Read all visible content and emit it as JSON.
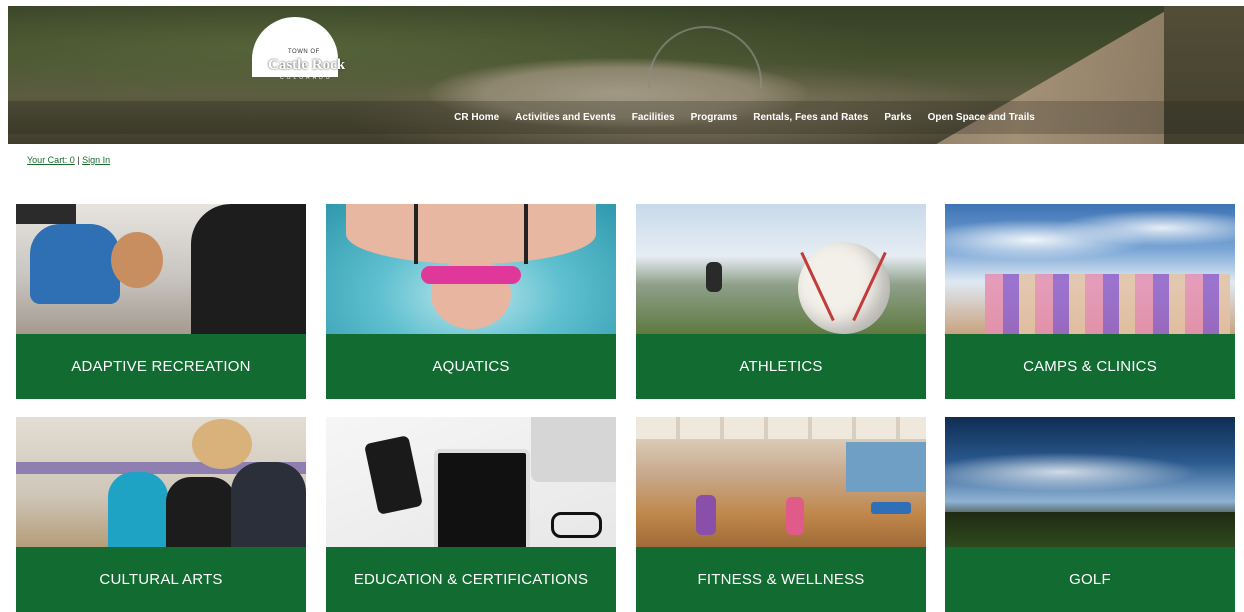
{
  "header": {
    "logo": {
      "town_of": "Town of",
      "name": "Castle Rock",
      "state": "Colorado"
    },
    "nav": [
      {
        "label": "CR Home"
      },
      {
        "label": "Activities and Events"
      },
      {
        "label": "Facilities"
      },
      {
        "label": "Programs"
      },
      {
        "label": "Rentals, Fees and Rates"
      },
      {
        "label": "Parks"
      },
      {
        "label": "Open Space and Trails"
      }
    ]
  },
  "account": {
    "cart_label": "Your Cart: 0",
    "separator": "|",
    "sign_in_label": "Sign In"
  },
  "categories": [
    {
      "label": "ADAPTIVE RECREATION"
    },
    {
      "label": "AQUATICS"
    },
    {
      "label": "ATHLETICS"
    },
    {
      "label": "CAMPS & CLINICS"
    },
    {
      "label": "CULTURAL ARTS"
    },
    {
      "label": "EDUCATION & CERTIFICATIONS"
    },
    {
      "label": "FITNESS & WELLNESS"
    },
    {
      "label": "GOLF"
    }
  ],
  "colors": {
    "tile_green": "#126b31",
    "link_green": "#1a6b2e"
  }
}
